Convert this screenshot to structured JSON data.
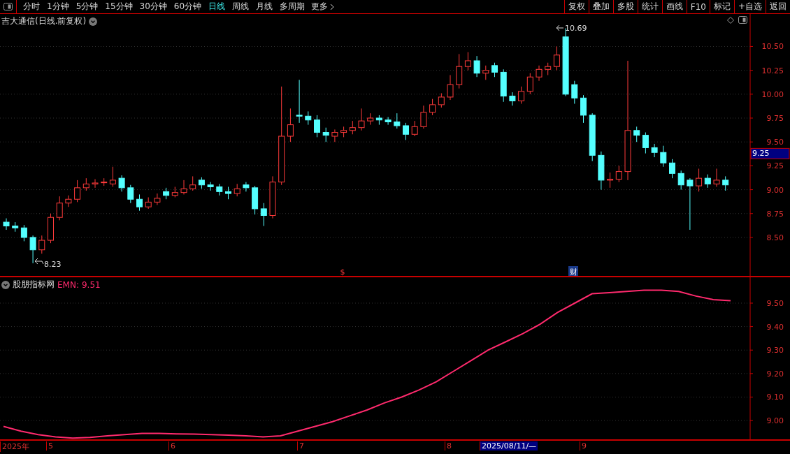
{
  "toolbar": {
    "periods": [
      {
        "label": "分时",
        "selected": false
      },
      {
        "label": "1分钟",
        "selected": false
      },
      {
        "label": "5分钟",
        "selected": false
      },
      {
        "label": "15分钟",
        "selected": false
      },
      {
        "label": "30分钟",
        "selected": false
      },
      {
        "label": "60分钟",
        "selected": false
      },
      {
        "label": "日线",
        "selected": true
      },
      {
        "label": "周线",
        "selected": false
      },
      {
        "label": "月线",
        "selected": false
      },
      {
        "label": "多周期",
        "selected": false
      }
    ],
    "more": "更多",
    "actions": [
      "复权",
      "叠加",
      "多股",
      "统计",
      "画线",
      "F10",
      "标记",
      "+自选",
      "返回"
    ]
  },
  "price_panel": {
    "title": "吉大通信(日线.前复权)",
    "current_price": "9.25",
    "high_label": "10.69",
    "low_label": "8.23",
    "event_markers": [
      {
        "label": "$",
        "kind": "dividend"
      },
      {
        "label": "财",
        "kind": "report"
      }
    ],
    "chart_data": {
      "type": "candlestick",
      "ylim": [
        8.09,
        10.84
      ],
      "grid": true,
      "yticks": [
        {
          "value": 10.5,
          "label": "10.50"
        },
        {
          "value": 10.25,
          "label": "10.25"
        },
        {
          "value": 10.0,
          "label": "10.00"
        },
        {
          "value": 9.75,
          "label": "9.75"
        },
        {
          "value": 9.5,
          "label": "9.50"
        },
        {
          "value": 9.25,
          "label": "9.25"
        },
        {
          "value": 9.0,
          "label": "9.00"
        },
        {
          "value": 8.75,
          "label": "8.75"
        },
        {
          "value": 8.5,
          "label": "8.50"
        }
      ],
      "ohlc": [
        [
          8.66,
          8.7,
          8.58,
          8.62
        ],
        [
          8.62,
          8.66,
          8.56,
          8.6
        ],
        [
          8.6,
          8.63,
          8.46,
          8.5
        ],
        [
          8.5,
          8.52,
          8.23,
          8.37
        ],
        [
          8.37,
          8.52,
          8.33,
          8.47
        ],
        [
          8.47,
          8.75,
          8.44,
          8.71
        ],
        [
          8.71,
          8.93,
          8.68,
          8.86
        ],
        [
          8.86,
          8.94,
          8.82,
          8.9
        ],
        [
          8.9,
          9.1,
          8.87,
          9.02
        ],
        [
          9.02,
          9.12,
          8.99,
          9.06
        ],
        [
          9.06,
          9.11,
          9.02,
          9.07
        ],
        [
          9.08,
          9.12,
          9.04,
          9.08
        ],
        [
          9.06,
          9.24,
          9.03,
          9.1
        ],
        [
          9.12,
          9.15,
          8.98,
          9.02
        ],
        [
          9.02,
          9.05,
          8.86,
          8.9
        ],
        [
          8.9,
          8.95,
          8.78,
          8.82
        ],
        [
          8.82,
          8.92,
          8.8,
          8.87
        ],
        [
          8.87,
          8.96,
          8.84,
          8.91
        ],
        [
          8.98,
          9.02,
          8.9,
          8.94
        ],
        [
          8.94,
          9.03,
          8.92,
          8.97
        ],
        [
          8.97,
          9.1,
          8.95,
          9.01
        ],
        [
          9.01,
          9.14,
          8.99,
          9.05
        ],
        [
          9.1,
          9.13,
          9.01,
          9.05
        ],
        [
          9.05,
          9.08,
          8.99,
          9.03
        ],
        [
          9.03,
          9.06,
          8.94,
          8.98
        ],
        [
          8.98,
          9.03,
          8.9,
          8.96
        ],
        [
          8.96,
          9.06,
          8.93,
          9.01
        ],
        [
          9.05,
          9.08,
          8.98,
          9.02
        ],
        [
          9.02,
          9.04,
          8.74,
          8.8
        ],
        [
          8.8,
          8.86,
          8.62,
          8.73
        ],
        [
          8.73,
          9.14,
          8.7,
          9.08
        ],
        [
          9.08,
          10.08,
          9.05,
          9.56
        ],
        [
          9.56,
          9.85,
          9.5,
          9.68
        ],
        [
          9.78,
          10.15,
          9.7,
          9.77
        ],
        [
          9.77,
          9.82,
          9.68,
          9.73
        ],
        [
          9.73,
          9.78,
          9.55,
          9.6
        ],
        [
          9.6,
          9.65,
          9.5,
          9.57
        ],
        [
          9.56,
          9.63,
          9.5,
          9.6
        ],
        [
          9.6,
          9.66,
          9.55,
          9.62
        ],
        [
          9.62,
          9.72,
          9.58,
          9.65
        ],
        [
          9.65,
          9.85,
          9.62,
          9.72
        ],
        [
          9.72,
          9.8,
          9.68,
          9.75
        ],
        [
          9.75,
          9.78,
          9.68,
          9.73
        ],
        [
          9.73,
          9.76,
          9.68,
          9.71
        ],
        [
          9.71,
          9.8,
          9.64,
          9.67
        ],
        [
          9.67,
          9.7,
          9.52,
          9.58
        ],
        [
          9.58,
          9.72,
          9.56,
          9.66
        ],
        [
          9.66,
          9.88,
          9.64,
          9.81
        ],
        [
          9.81,
          9.95,
          9.78,
          9.89
        ],
        [
          9.89,
          10.01,
          9.86,
          9.97
        ],
        [
          9.97,
          10.2,
          9.94,
          10.1
        ],
        [
          10.1,
          10.42,
          10.06,
          10.29
        ],
        [
          10.29,
          10.44,
          10.25,
          10.35
        ],
        [
          10.35,
          10.4,
          10.18,
          10.22
        ],
        [
          10.22,
          10.3,
          10.15,
          10.25
        ],
        [
          10.3,
          10.33,
          10.18,
          10.23
        ],
        [
          10.23,
          10.26,
          9.92,
          9.98
        ],
        [
          9.98,
          10.02,
          9.88,
          9.93
        ],
        [
          9.93,
          10.08,
          9.9,
          10.03
        ],
        [
          10.03,
          10.22,
          10.0,
          10.18
        ],
        [
          10.18,
          10.3,
          10.14,
          10.26
        ],
        [
          10.26,
          10.33,
          10.2,
          10.29
        ],
        [
          10.29,
          10.5,
          10.25,
          10.41
        ],
        [
          10.6,
          10.69,
          9.98,
          10.0
        ],
        [
          10.1,
          10.14,
          9.9,
          9.96
        ],
        [
          9.96,
          9.99,
          9.7,
          9.78
        ],
        [
          9.78,
          9.8,
          9.3,
          9.36
        ],
        [
          9.36,
          9.4,
          9.0,
          9.1
        ],
        [
          9.1,
          9.18,
          9.02,
          9.11
        ],
        [
          9.11,
          9.25,
          9.08,
          9.19
        ],
        [
          9.19,
          10.35,
          9.1,
          9.62
        ],
        [
          9.62,
          9.66,
          9.5,
          9.57
        ],
        [
          9.57,
          9.6,
          9.38,
          9.44
        ],
        [
          9.44,
          9.48,
          9.34,
          9.39
        ],
        [
          9.39,
          9.46,
          9.24,
          9.28
        ],
        [
          9.28,
          9.32,
          9.12,
          9.17
        ],
        [
          9.17,
          9.2,
          9.0,
          9.05
        ],
        [
          9.1,
          9.12,
          8.58,
          9.04
        ],
        [
          9.04,
          9.22,
          8.98,
          9.12
        ],
        [
          9.12,
          9.16,
          9.02,
          9.06
        ],
        [
          9.06,
          9.22,
          9.03,
          9.1
        ],
        [
          9.1,
          9.14,
          8.99,
          9.05
        ]
      ]
    }
  },
  "indicator_panel": {
    "name": "股朋指标网",
    "reading": "9.51",
    "chart_data": {
      "type": "line",
      "ylim": [
        8.92,
        9.61
      ],
      "grid": true,
      "yticks": [
        {
          "value": 9.0,
          "label": "9.00"
        },
        {
          "value": 9.1,
          "label": "9.10"
        },
        {
          "value": 9.2,
          "label": "9.20"
        },
        {
          "value": 9.3,
          "label": "9.30"
        },
        {
          "value": 9.4,
          "label": "9.40"
        },
        {
          "value": 9.5,
          "label": "9.50"
        }
      ],
      "series": [
        {
          "name": "EMN:",
          "color": "#ff2a6d",
          "values": [
            8.975,
            8.955,
            8.94,
            8.93,
            8.925,
            8.928,
            8.935,
            8.94,
            8.945,
            8.945,
            8.943,
            8.942,
            8.94,
            8.938,
            8.935,
            8.93,
            8.935,
            8.955,
            8.975,
            8.995,
            9.02,
            9.045,
            9.075,
            9.1,
            9.13,
            9.165,
            9.21,
            9.255,
            9.3,
            9.335,
            9.37,
            9.41,
            9.46,
            9.5,
            9.54,
            9.545,
            9.55,
            9.555,
            9.555,
            9.55,
            9.53,
            9.515,
            9.51
          ]
        }
      ]
    }
  },
  "date_axis": {
    "labels": [
      {
        "label": "2025年",
        "selected": false
      },
      {
        "label": "5",
        "selected": false
      },
      {
        "label": "6",
        "selected": false
      },
      {
        "label": "7",
        "selected": false
      },
      {
        "label": "8",
        "selected": false
      },
      {
        "label": "2025/08/11/—",
        "selected": true
      },
      {
        "label": "9",
        "selected": false
      }
    ]
  }
}
